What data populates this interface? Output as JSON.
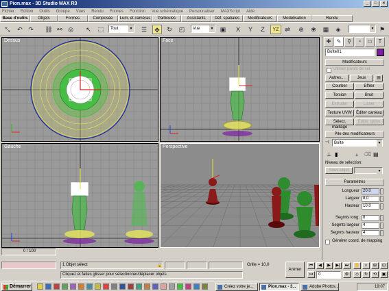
{
  "window": {
    "title": "Pion.max - 3D Studio MAX R3"
  },
  "menu": [
    "Fichier",
    "Edition",
    "Outils",
    "Groupe",
    "Vues",
    "Rendu",
    "Fonnes",
    "Fonction",
    "Vue schématique",
    "Personnaliser",
    "MAXScript",
    "Aide"
  ],
  "tabs": [
    {
      "label": "Base d'outils",
      "w": 44
    },
    {
      "label": "Objets",
      "w": 40
    },
    {
      "label": "Formes",
      "w": 44
    },
    {
      "label": "Composée",
      "w": 44
    },
    {
      "label": "Lum. et caméras",
      "w": 50
    },
    {
      "label": "Particules",
      "w": 42
    },
    {
      "label": "Assistants",
      "w": 44
    },
    {
      "label": "Déf. spatiales",
      "w": 46
    },
    {
      "label": "Modificateurs",
      "w": 50
    },
    {
      "label": "Modélisation",
      "w": 50
    },
    {
      "label": "Rendu",
      "w": 60
    }
  ],
  "toolbar": {
    "selection_filter": "Tout",
    "coord_system": "Vue"
  },
  "viewports": {
    "top": "Dessus",
    "front": "Face",
    "left": "Gauche",
    "perspective": "Perspective"
  },
  "panel": {
    "object_name": "Boîte01",
    "color": "#7b1fa2",
    "modifiers_header": "Modificateurs",
    "use_pivot_label": "Utiliser pivots de sel.",
    "others_btn": "Autres...",
    "sets_btn": "Jeux",
    "buttons": [
      {
        "label": "Courber",
        "disabled": false
      },
      {
        "label": "Effiler",
        "disabled": false
      },
      {
        "label": "Torsion",
        "disabled": false
      },
      {
        "label": "Bruit",
        "disabled": false
      },
      {
        "label": "Extruder",
        "disabled": true
      },
      {
        "label": "Lisser",
        "disabled": true
      },
      {
        "label": "Texture UVW",
        "disabled": false
      },
      {
        "label": "Éditer carreau",
        "disabled": false
      },
      {
        "label": "Sélect. maillage",
        "disabled": false
      },
      {
        "label": "Éditer spline",
        "disabled": true
      }
    ],
    "stack_header": "Pile des modificateurs",
    "stack_value": "Boîte",
    "selection_level_label": "Niveau de sélection:",
    "selection_level_value": "Sous-objet",
    "params_header": "Paramètres",
    "params": [
      {
        "label": "Longueur",
        "value": "20,0"
      },
      {
        "label": "Largeur",
        "value": "8,0"
      },
      {
        "label": "Hauteur",
        "value": "10,0"
      },
      {
        "label": "Segmts long.",
        "value": "8"
      },
      {
        "label": "Segmts largeur",
        "value": "4"
      },
      {
        "label": "Segmts hauteur",
        "value": "4"
      }
    ],
    "gen_mapping_label": "Générer coord. de mapping"
  },
  "status": {
    "time": "0 / 100",
    "selected": "1 Objet sélect",
    "prompt": "Cliquez et faites glisser pour sélectionner/déplacer objets",
    "grid": "Grille = 10,0",
    "animate": "Animer",
    "frame": "0"
  },
  "taskbar": {
    "start": "Démarrer",
    "items": [
      {
        "label": "Créez votre je...",
        "active": false
      },
      {
        "label": "Pion.max - 3...",
        "active": true
      },
      {
        "label": "Adobe Photos...",
        "active": false
      }
    ],
    "clock": "19:07"
  },
  "colors": {
    "grid_bg": "#9a9a9a",
    "wire_green": "#3fbf3f",
    "wire_yellow": "#e6e65a",
    "piece_dark_red": "#7a1010",
    "piece_green": "#2e8b2e"
  }
}
